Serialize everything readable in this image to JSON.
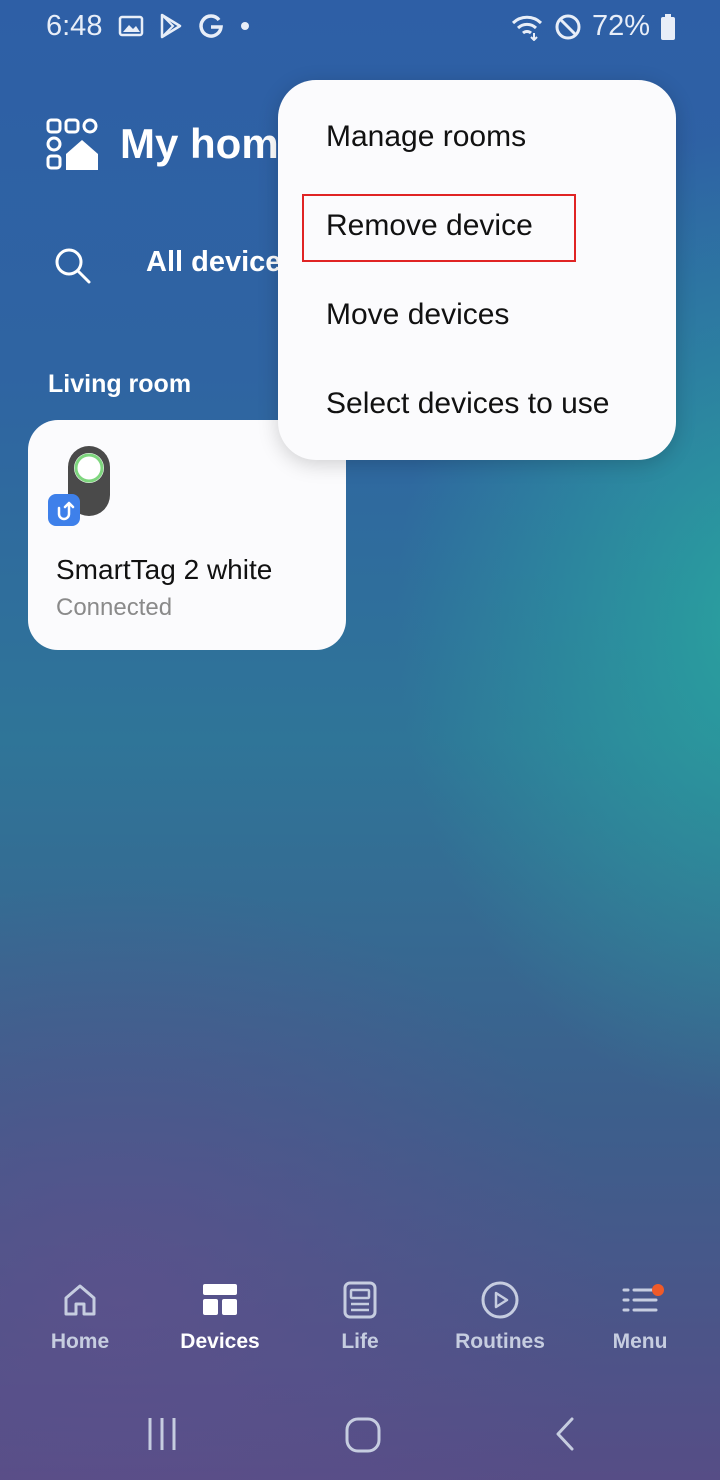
{
  "status_bar": {
    "time": "6:48",
    "battery_percent": "72%",
    "left_icons": [
      "gallery-icon",
      "play-store-icon",
      "google-icon",
      "dot-icon"
    ],
    "right_icons": [
      "wifi-icon",
      "do-not-disturb-icon",
      "battery-icon"
    ]
  },
  "header": {
    "title": "My home",
    "logo_icon": "home-grid-icon"
  },
  "filter": {
    "search_icon": "search-icon",
    "label": "All devices"
  },
  "room": {
    "label": "Living room",
    "devices": [
      {
        "name": "SmartTag 2 white",
        "status": "Connected",
        "icon": "smarttag-icon",
        "badge_icon": "share-badge-icon"
      }
    ]
  },
  "popup_menu": {
    "items": [
      {
        "label": "Manage rooms"
      },
      {
        "label": "Remove device",
        "highlighted": true
      },
      {
        "label": "Move devices"
      },
      {
        "label": "Select devices to use"
      }
    ],
    "highlight_color": "#e02424"
  },
  "bottom_nav": {
    "items": [
      {
        "label": "Home",
        "icon": "home-icon",
        "active": false
      },
      {
        "label": "Devices",
        "icon": "devices-grid-icon",
        "active": true
      },
      {
        "label": "Life",
        "icon": "life-icon",
        "active": false
      },
      {
        "label": "Routines",
        "icon": "play-circle-icon",
        "active": false
      },
      {
        "label": "Menu",
        "icon": "menu-icon",
        "active": false,
        "notification_dot": true
      }
    ],
    "dot_color": "#f05a28"
  },
  "system_nav": {
    "buttons": [
      "recents-icon",
      "home-button-icon",
      "back-icon"
    ]
  }
}
